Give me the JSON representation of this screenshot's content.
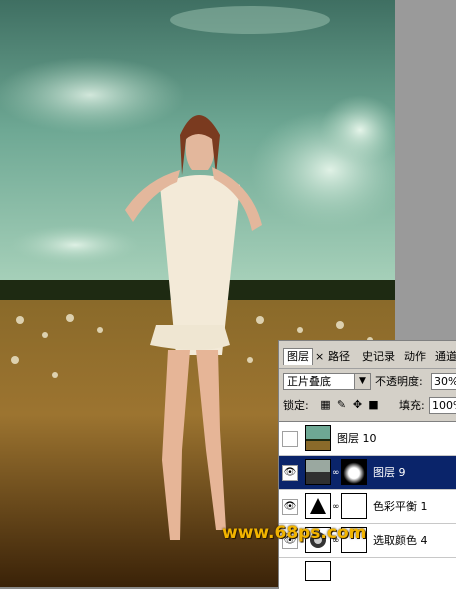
{
  "colors": {
    "accent": "#0a246a",
    "panel_bg": "#d4d0c8",
    "watermark": "#f2b400"
  },
  "tabs": [
    {
      "label": "图层"
    },
    {
      "label": "×"
    },
    {
      "label": "路径"
    },
    {
      "label": "史记录"
    },
    {
      "label": "动作"
    },
    {
      "label": "通道"
    }
  ],
  "blend": {
    "mode": "正片叠底",
    "opacity_label": "不透明度:",
    "opacity_value": "30%"
  },
  "lock": {
    "label": "锁定:",
    "fill_label": "填充:",
    "fill_value": "100%"
  },
  "layers": [
    {
      "name": "图层 10",
      "visible": false,
      "selected": false,
      "icon": "photo-thumb"
    },
    {
      "name": "图层 9",
      "visible": true,
      "selected": true,
      "icon": "photo-thumb"
    },
    {
      "name": "色彩平衡 1",
      "visible": true,
      "selected": false,
      "icon": "color-balance-icon"
    },
    {
      "name": "选取颜色 4",
      "visible": true,
      "selected": false,
      "icon": "selective-color-icon"
    }
  ],
  "watermark": {
    "text": "www.68ps.com"
  }
}
